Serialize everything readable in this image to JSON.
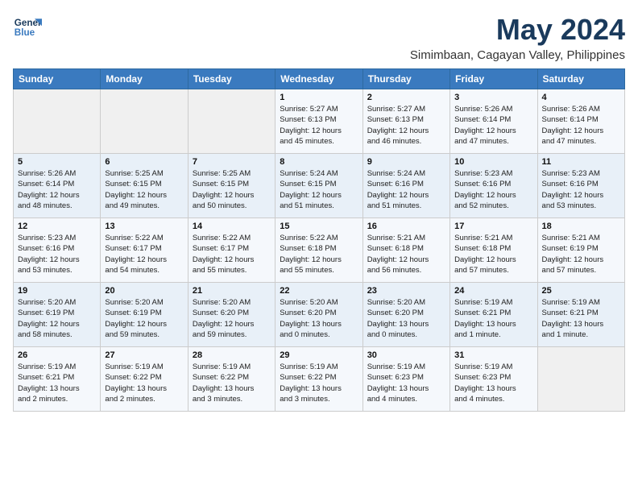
{
  "logo": {
    "line1": "General",
    "line2": "Blue"
  },
  "title": "May 2024",
  "subtitle": "Simimbaan, Cagayan Valley, Philippines",
  "days_header": [
    "Sunday",
    "Monday",
    "Tuesday",
    "Wednesday",
    "Thursday",
    "Friday",
    "Saturday"
  ],
  "weeks": [
    [
      {
        "day": "",
        "info": ""
      },
      {
        "day": "",
        "info": ""
      },
      {
        "day": "",
        "info": ""
      },
      {
        "day": "1",
        "info": "Sunrise: 5:27 AM\nSunset: 6:13 PM\nDaylight: 12 hours\nand 45 minutes."
      },
      {
        "day": "2",
        "info": "Sunrise: 5:27 AM\nSunset: 6:13 PM\nDaylight: 12 hours\nand 46 minutes."
      },
      {
        "day": "3",
        "info": "Sunrise: 5:26 AM\nSunset: 6:14 PM\nDaylight: 12 hours\nand 47 minutes."
      },
      {
        "day": "4",
        "info": "Sunrise: 5:26 AM\nSunset: 6:14 PM\nDaylight: 12 hours\nand 47 minutes."
      }
    ],
    [
      {
        "day": "5",
        "info": "Sunrise: 5:26 AM\nSunset: 6:14 PM\nDaylight: 12 hours\nand 48 minutes."
      },
      {
        "day": "6",
        "info": "Sunrise: 5:25 AM\nSunset: 6:15 PM\nDaylight: 12 hours\nand 49 minutes."
      },
      {
        "day": "7",
        "info": "Sunrise: 5:25 AM\nSunset: 6:15 PM\nDaylight: 12 hours\nand 50 minutes."
      },
      {
        "day": "8",
        "info": "Sunrise: 5:24 AM\nSunset: 6:15 PM\nDaylight: 12 hours\nand 51 minutes."
      },
      {
        "day": "9",
        "info": "Sunrise: 5:24 AM\nSunset: 6:16 PM\nDaylight: 12 hours\nand 51 minutes."
      },
      {
        "day": "10",
        "info": "Sunrise: 5:23 AM\nSunset: 6:16 PM\nDaylight: 12 hours\nand 52 minutes."
      },
      {
        "day": "11",
        "info": "Sunrise: 5:23 AM\nSunset: 6:16 PM\nDaylight: 12 hours\nand 53 minutes."
      }
    ],
    [
      {
        "day": "12",
        "info": "Sunrise: 5:23 AM\nSunset: 6:16 PM\nDaylight: 12 hours\nand 53 minutes."
      },
      {
        "day": "13",
        "info": "Sunrise: 5:22 AM\nSunset: 6:17 PM\nDaylight: 12 hours\nand 54 minutes."
      },
      {
        "day": "14",
        "info": "Sunrise: 5:22 AM\nSunset: 6:17 PM\nDaylight: 12 hours\nand 55 minutes."
      },
      {
        "day": "15",
        "info": "Sunrise: 5:22 AM\nSunset: 6:18 PM\nDaylight: 12 hours\nand 55 minutes."
      },
      {
        "day": "16",
        "info": "Sunrise: 5:21 AM\nSunset: 6:18 PM\nDaylight: 12 hours\nand 56 minutes."
      },
      {
        "day": "17",
        "info": "Sunrise: 5:21 AM\nSunset: 6:18 PM\nDaylight: 12 hours\nand 57 minutes."
      },
      {
        "day": "18",
        "info": "Sunrise: 5:21 AM\nSunset: 6:19 PM\nDaylight: 12 hours\nand 57 minutes."
      }
    ],
    [
      {
        "day": "19",
        "info": "Sunrise: 5:20 AM\nSunset: 6:19 PM\nDaylight: 12 hours\nand 58 minutes."
      },
      {
        "day": "20",
        "info": "Sunrise: 5:20 AM\nSunset: 6:19 PM\nDaylight: 12 hours\nand 59 minutes."
      },
      {
        "day": "21",
        "info": "Sunrise: 5:20 AM\nSunset: 6:20 PM\nDaylight: 12 hours\nand 59 minutes."
      },
      {
        "day": "22",
        "info": "Sunrise: 5:20 AM\nSunset: 6:20 PM\nDaylight: 13 hours\nand 0 minutes."
      },
      {
        "day": "23",
        "info": "Sunrise: 5:20 AM\nSunset: 6:20 PM\nDaylight: 13 hours\nand 0 minutes."
      },
      {
        "day": "24",
        "info": "Sunrise: 5:19 AM\nSunset: 6:21 PM\nDaylight: 13 hours\nand 1 minute."
      },
      {
        "day": "25",
        "info": "Sunrise: 5:19 AM\nSunset: 6:21 PM\nDaylight: 13 hours\nand 1 minute."
      }
    ],
    [
      {
        "day": "26",
        "info": "Sunrise: 5:19 AM\nSunset: 6:21 PM\nDaylight: 13 hours\nand 2 minutes."
      },
      {
        "day": "27",
        "info": "Sunrise: 5:19 AM\nSunset: 6:22 PM\nDaylight: 13 hours\nand 2 minutes."
      },
      {
        "day": "28",
        "info": "Sunrise: 5:19 AM\nSunset: 6:22 PM\nDaylight: 13 hours\nand 3 minutes."
      },
      {
        "day": "29",
        "info": "Sunrise: 5:19 AM\nSunset: 6:22 PM\nDaylight: 13 hours\nand 3 minutes."
      },
      {
        "day": "30",
        "info": "Sunrise: 5:19 AM\nSunset: 6:23 PM\nDaylight: 13 hours\nand 4 minutes."
      },
      {
        "day": "31",
        "info": "Sunrise: 5:19 AM\nSunset: 6:23 PM\nDaylight: 13 hours\nand 4 minutes."
      },
      {
        "day": "",
        "info": ""
      }
    ]
  ]
}
